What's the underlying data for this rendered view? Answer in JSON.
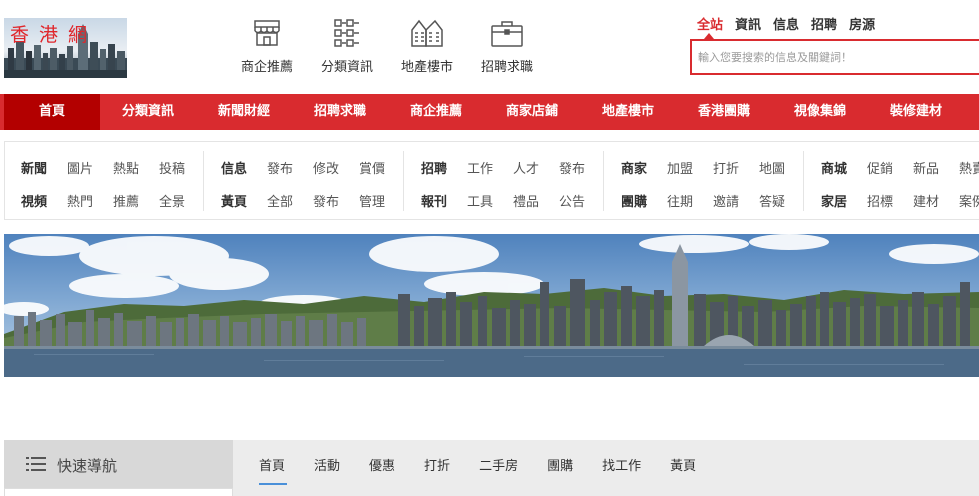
{
  "header": {
    "logo_text": "香港網",
    "quick_links": [
      {
        "label": "商企推薦",
        "icon": "storefront-icon"
      },
      {
        "label": "分類資訊",
        "icon": "qr-list-icon"
      },
      {
        "label": "地產樓市",
        "icon": "building-icon"
      },
      {
        "label": "招聘求職",
        "icon": "briefcase-icon"
      }
    ]
  },
  "search": {
    "tabs": [
      "全站",
      "資訊",
      "信息",
      "招聘",
      "房源"
    ],
    "active_tab": "全站",
    "placeholder": "輸入您要搜索的信息及關鍵詞！"
  },
  "nav": {
    "items": [
      "首頁",
      "分類資訊",
      "新聞財經",
      "招聘求職",
      "商企推薦",
      "商家店鋪",
      "地產樓市",
      "香港團購",
      "視像集錦",
      "裝修建材"
    ],
    "active": "首頁"
  },
  "categories": [
    {
      "row1": [
        "新聞",
        "圖片",
        "熱點",
        "投稿"
      ],
      "row2": [
        "視頻",
        "熱門",
        "推薦",
        "全景"
      ]
    },
    {
      "row1": [
        "信息",
        "發布",
        "修改",
        "賞價"
      ],
      "row2": [
        "黃頁",
        "全部",
        "發布",
        "管理"
      ]
    },
    {
      "row1": [
        "招聘",
        "工作",
        "人才",
        "發布"
      ],
      "row2": [
        "報刊",
        "工具",
        "禮品",
        "公告"
      ]
    },
    {
      "row1": [
        "商家",
        "加盟",
        "打折",
        "地圖"
      ],
      "row2": [
        "團購",
        "往期",
        "邀請",
        "答疑"
      ]
    },
    {
      "row1": [
        "商城",
        "促銷",
        "新品",
        "熱賣"
      ],
      "row2": [
        "家居",
        "招標",
        "建材",
        "案例"
      ]
    }
  ],
  "bottom": {
    "quick_nav_label": "快速導航",
    "tabs": [
      "首頁",
      "活動",
      "優惠",
      "打折",
      "二手房",
      "團購",
      "找工作",
      "黃頁"
    ],
    "active_tab": "首頁"
  },
  "colors": {
    "brand_red": "#d92b2f",
    "active_nav": "#b30000",
    "tab_underline": "#4a90d9"
  }
}
